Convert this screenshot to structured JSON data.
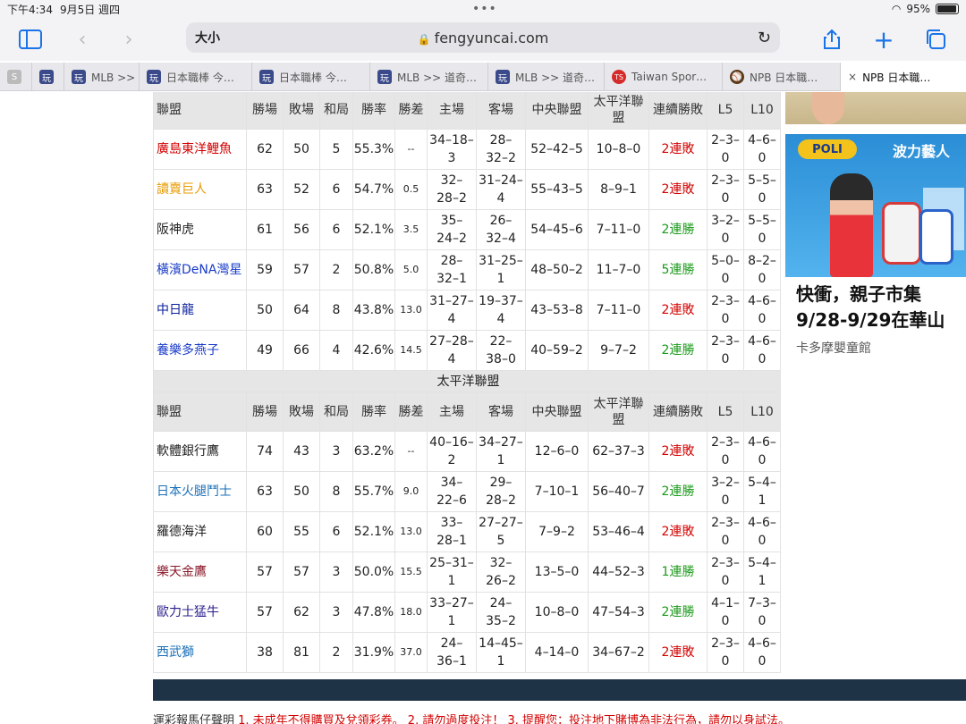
{
  "status": {
    "time": "下午4:34",
    "date": "9月5日 週四",
    "battery": "95%"
  },
  "browser": {
    "text_size": "大小",
    "url": "fengyuncai.com"
  },
  "tabs": [
    {
      "icon": "S",
      "label": ""
    },
    {
      "icon": "玩",
      "label": ""
    },
    {
      "icon": "玩",
      "label": "MLB >> 道…"
    },
    {
      "icon": "玩",
      "label": "日本職棒 今…"
    },
    {
      "icon": "玩",
      "label": "日本職棒 今…"
    },
    {
      "icon": "玩",
      "label": "MLB >> 道奇…"
    },
    {
      "icon": "玩",
      "label": "MLB >> 道奇…"
    },
    {
      "icon": "TS",
      "label": "Taiwan Spor…"
    },
    {
      "icon": "⚾",
      "label": "NPB 日本職…"
    },
    {
      "icon": "×",
      "label": "NPB 日本職…"
    }
  ],
  "table": {
    "headers": [
      "聯盟",
      "勝場",
      "敗場",
      "和局",
      "勝率",
      "勝差",
      "主場",
      "客場",
      "中央聯盟",
      "太平洋聯盟",
      "連續勝敗",
      "L5",
      "L10"
    ],
    "central_rows": [
      {
        "team": "廣島東洋鯉魚",
        "color": "#d40000",
        "w": "62",
        "l": "50",
        "t": "5",
        "pct": "55.3%",
        "gb": "--",
        "home1": "34–18–",
        "home2": "3",
        "away1": "28–",
        "away2": "32–2",
        "cl": "52–42–5",
        "pl": "10–8–0",
        "streak": "2連敗",
        "streak_type": "lose",
        "l5a": "2–3–",
        "l5b": "0",
        "l10a": "4–6–",
        "l10b": "0"
      },
      {
        "team": "讀賣巨人",
        "color": "#e89a00",
        "w": "63",
        "l": "52",
        "t": "6",
        "pct": "54.7%",
        "gb": "0.5",
        "home1": "32–",
        "home2": "28–2",
        "away1": "31–24–",
        "away2": "4",
        "cl": "55–43–5",
        "pl": "8–9–1",
        "streak": "2連敗",
        "streak_type": "lose",
        "l5a": "2–3–",
        "l5b": "0",
        "l10a": "5–5–",
        "l10b": "0"
      },
      {
        "team": "阪神虎",
        "color": "#222222",
        "w": "61",
        "l": "56",
        "t": "6",
        "pct": "52.1%",
        "gb": "3.5",
        "home1": "35–",
        "home2": "24–2",
        "away1": "26–",
        "away2": "32–4",
        "cl": "54–45–6",
        "pl": "7–11–0",
        "streak": "2連勝",
        "streak_type": "win",
        "l5a": "3–2–",
        "l5b": "0",
        "l10a": "5–5–",
        "l10b": "0"
      },
      {
        "team": "橫濱DeNA灣星",
        "color": "#1a3cc8",
        "w": "59",
        "l": "57",
        "t": "2",
        "pct": "50.8%",
        "gb": "5.0",
        "home1": "28–",
        "home2": "32–1",
        "away1": "31–25–",
        "away2": "1",
        "cl": "48–50–2",
        "pl": "11–7–0",
        "streak": "5連勝",
        "streak_type": "win",
        "l5a": "5–0–",
        "l5b": "0",
        "l10a": "8–2–",
        "l10b": "0"
      },
      {
        "team": "中日龍",
        "color": "#0a1f9c",
        "w": "50",
        "l": "64",
        "t": "8",
        "pct": "43.8%",
        "gb": "13.0",
        "home1": "31–27–",
        "home2": "4",
        "away1": "19–37–",
        "away2": "4",
        "cl": "43–53–8",
        "pl": "7–11–0",
        "streak": "2連敗",
        "streak_type": "lose",
        "l5a": "2–3–",
        "l5b": "0",
        "l10a": "4–6–",
        "l10b": "0"
      },
      {
        "team": "養樂多燕子",
        "color": "#1a3cc8",
        "w": "49",
        "l": "66",
        "t": "4",
        "pct": "42.6%",
        "gb": "14.5",
        "home1": "27–28–",
        "home2": "4",
        "away1": "22–",
        "away2": "38–0",
        "cl": "40–59–2",
        "pl": "9–7–2",
        "streak": "2連勝",
        "streak_type": "win",
        "l5a": "2–3–",
        "l5b": "0",
        "l10a": "4–6–",
        "l10b": "0"
      }
    ],
    "pacific_title": "太平洋聯盟",
    "pacific_rows": [
      {
        "team": "軟體銀行鷹",
        "color": "#222222",
        "w": "74",
        "l": "43",
        "t": "3",
        "pct": "63.2%",
        "gb": "--",
        "home1": "40–16–",
        "home2": "2",
        "away1": "34–27–",
        "away2": "1",
        "cl": "12–6–0",
        "pl": "62–37–3",
        "streak": "2連敗",
        "streak_type": "lose",
        "l5a": "2–3–",
        "l5b": "0",
        "l10a": "4–6–",
        "l10b": "0"
      },
      {
        "team": "日本火腿鬥士",
        "color": "#1a6fb8",
        "w": "63",
        "l": "50",
        "t": "8",
        "pct": "55.7%",
        "gb": "9.0",
        "home1": "34–",
        "home2": "22–6",
        "away1": "29–",
        "away2": "28–2",
        "cl": "7–10–1",
        "pl": "56–40–7",
        "streak": "2連勝",
        "streak_type": "win",
        "l5a": "3–2–",
        "l5b": "0",
        "l10a": "5–4–",
        "l10b": "1"
      },
      {
        "team": "羅德海洋",
        "color": "#222222",
        "w": "60",
        "l": "55",
        "t": "6",
        "pct": "52.1%",
        "gb": "13.0",
        "home1": "33–",
        "home2": "28–1",
        "away1": "27–27–",
        "away2": "5",
        "cl": "7–9–2",
        "pl": "53–46–4",
        "streak": "2連敗",
        "streak_type": "lose",
        "l5a": "2–3–",
        "l5b": "0",
        "l10a": "4–6–",
        "l10b": "0"
      },
      {
        "team": "樂天金鷹",
        "color": "#8a1a2a",
        "w": "57",
        "l": "57",
        "t": "3",
        "pct": "50.0%",
        "gb": "15.5",
        "home1": "25–31–",
        "home2": "1",
        "away1": "32–",
        "away2": "26–2",
        "cl": "13–5–0",
        "pl": "44–52–3",
        "streak": "1連勝",
        "streak_type": "win",
        "l5a": "2–3–",
        "l5b": "0",
        "l10a": "5–4–",
        "l10b": "1"
      },
      {
        "team": "歐力士猛牛",
        "color": "#2a1f8c",
        "w": "57",
        "l": "62",
        "t": "3",
        "pct": "47.8%",
        "gb": "18.0",
        "home1": "33–27–",
        "home2": "1",
        "away1": "24–",
        "away2": "35–2",
        "cl": "10–8–0",
        "pl": "47–54–3",
        "streak": "2連勝",
        "streak_type": "win",
        "l5a": "4–1–",
        "l5b": "0",
        "l10a": "7–3–",
        "l10b": "0"
      },
      {
        "team": "西武獅",
        "color": "#1a6fb8",
        "w": "38",
        "l": "81",
        "t": "2",
        "pct": "31.9%",
        "gb": "37.0",
        "home1": "24–",
        "home2": "36–1",
        "away1": "14–45–",
        "away2": "1",
        "cl": "4–14–0",
        "pl": "34–67–2",
        "streak": "2連敗",
        "streak_type": "lose",
        "l5a": "2–3–",
        "l5b": "0",
        "l10a": "4–6–",
        "l10b": "0"
      }
    ]
  },
  "ad": {
    "banner_brand": "POLI",
    "banner_title": "波力藝人",
    "headline": "快衝，親子市集 9/28-9/29在華山",
    "source": "卡多摩嬰童館"
  },
  "disclaimer": {
    "prefix": "運彩報馬仔聲明 ",
    "text": "1. 未成年不得購買及兌領彩券。 2. 請勿過度投注！ 3. 提醒您：投注地下賭博為非法行為，請勿以身試法。"
  }
}
